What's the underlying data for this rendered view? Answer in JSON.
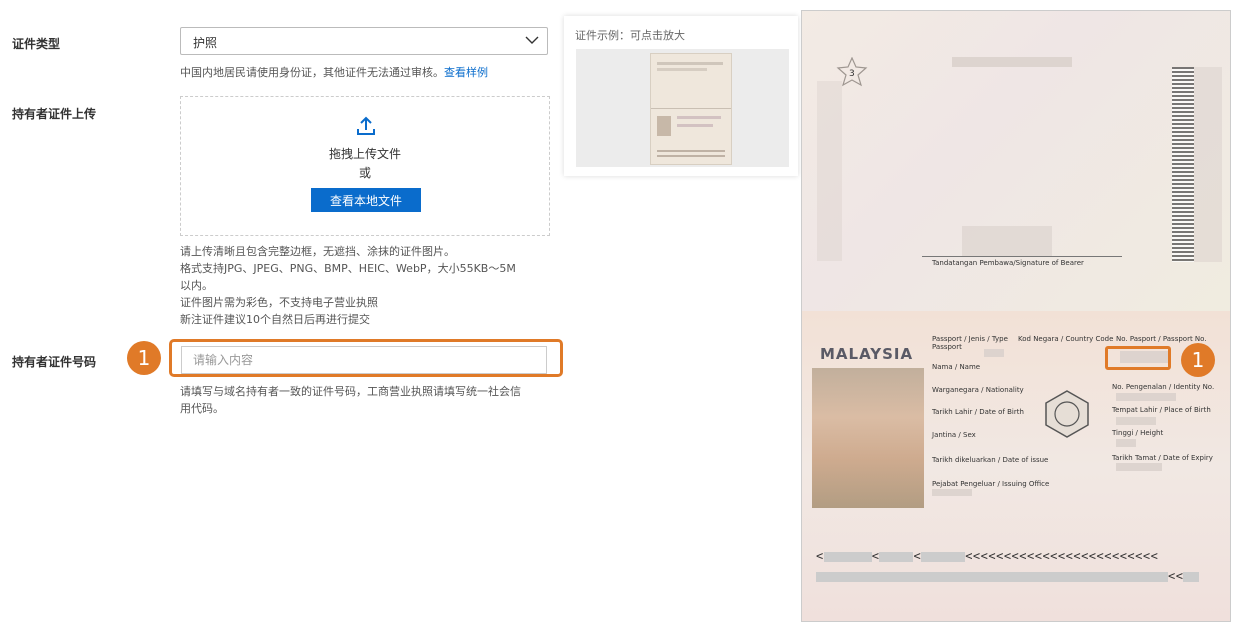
{
  "form": {
    "doc_type": {
      "label": "证件类型",
      "selected": "护照",
      "hint": "中国内地居民请使用身份证，其他证件无法通过审核。",
      "hint_link": "查看样例"
    },
    "upload": {
      "label": "持有者证件上传",
      "drag_text": "拖拽上传文件",
      "or_text": "或",
      "button_label": "查看本地文件",
      "hints": [
        "请上传清晰且包含完整边框，无遮挡、涂抹的证件图片。",
        "格式支持JPG、JPEG、PNG、BMP、HEIC、WebP，大小55KB～5M",
        "以内。",
        "证件图片需为彩色，不支持电子营业执照",
        "新注证件建议10个自然日后再进行提交"
      ]
    },
    "doc_number": {
      "label": "持有者证件号码",
      "placeholder": "请输入内容",
      "hints": [
        "请填写与域名持有者一致的证件号码，工商营业执照请填写统一社会信",
        "用代码。"
      ]
    }
  },
  "sample": {
    "title": "证件示例：可点击放大"
  },
  "callouts": {
    "left_number": "1",
    "right_number": "1",
    "color": "#e07a28"
  },
  "passport": {
    "page_number": "3",
    "signature_label": "Tandatangan Pembawa/Signature of Bearer",
    "country": "MALAYSIA",
    "fields": {
      "passport": "Passport / Jenis / Type",
      "passport_sub": "Passport",
      "country_code": "Kod Negara / Country Code",
      "passport_no": "No. Pasport / Passport No.",
      "name": "Nama / Name",
      "nationality": "Warganegara / Nationality",
      "id_no": "No. Pengenalan / Identity No.",
      "dob": "Tarikh Lahir / Date of Birth",
      "pob": "Tempat Lahir / Place of Birth",
      "sex": "Jantina / Sex",
      "height": "Tinggi / Height",
      "issue": "Tarikh dikeluarkan / Date of issue",
      "expiry": "Tarikh Tamat / Date of Expiry",
      "authority": "Pejabat Pengeluar / Issuing Office"
    },
    "mrz_line1": "<<<<<<<<<<<<<<<<<<<<<<<<<",
    "mrz_line2": "<<"
  }
}
